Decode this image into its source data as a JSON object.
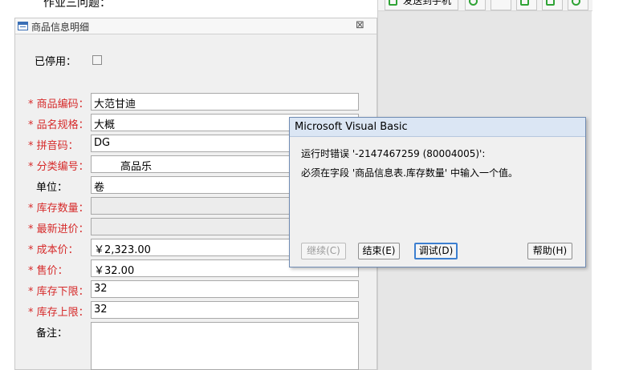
{
  "background_heading": "作业三问题：",
  "right_toolbar": {
    "send_to_phone_label": "发送到手机",
    "icons": [
      "cloud-icon",
      "expand-icon",
      "download-icon",
      "share-icon",
      "settings-icon"
    ]
  },
  "form": {
    "title": "商品信息明细",
    "close_glyph": "⊠",
    "disabled_label": "已停用：",
    "fields": {
      "code_label": "* 商品编码：",
      "code_value": "大范甘迪",
      "spec_label": "* 品名规格：",
      "spec_value": "大概",
      "pinyin_label": "* 拼音码：",
      "pinyin_value": "DG",
      "category_label": "* 分类编号：",
      "category_value": "        高品乐",
      "unit_label": "单位：",
      "unit_value": "卷",
      "stock_qty_label": "* 库存数量：",
      "latest_price_label": "* 最新进价：",
      "cost_label": "* 成本价：",
      "cost_value": "￥2,323.00",
      "sale_price_label": "* 售价：",
      "sale_price_value": "￥32.00",
      "min_stock_label": "* 库存下限：",
      "min_stock_value": "32",
      "max_stock_label": "* 库存上限：",
      "max_stock_value": "32",
      "note_label": "备注："
    }
  },
  "dialog": {
    "title": "Microsoft Visual Basic",
    "message_line1": "运行时错误 '-2147467259 (80004005)':",
    "message_line2": "必须在字段 '商品信息表.库存数量' 中输入一个值。",
    "buttons": {
      "continue": "继续(C)",
      "end": "结束(E)",
      "debug": "调试(D)",
      "help": "帮助(H)"
    }
  },
  "colors": {
    "required_label": "#d62a2a",
    "dialog_border": "#6f8bb3",
    "default_button_border": "#3c7fd0",
    "toolbar_icon": "#2fa335"
  }
}
